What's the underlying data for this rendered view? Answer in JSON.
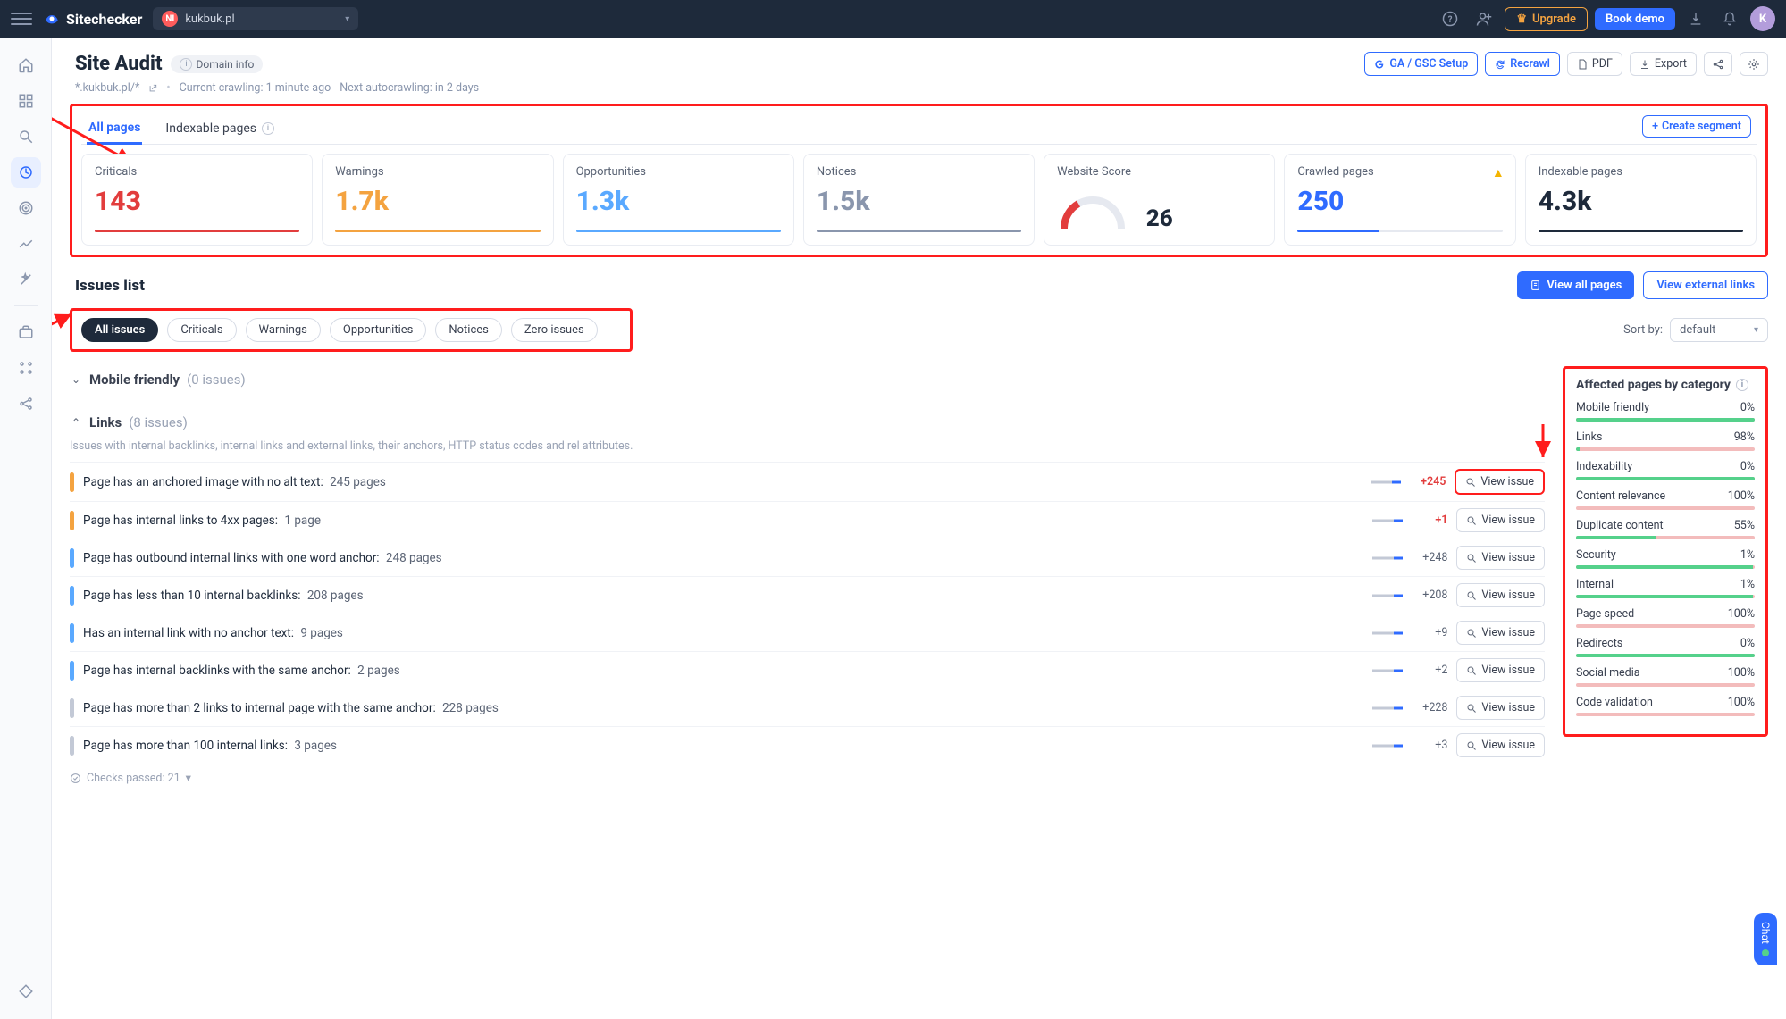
{
  "app": {
    "name": "Sitechecker"
  },
  "project": {
    "badge": "NI",
    "name": "kukbuk.pl"
  },
  "top": {
    "upgrade": "Upgrade",
    "book_demo": "Book demo",
    "avatar_initial": "K"
  },
  "page": {
    "title": "Site Audit",
    "domain_info": "Domain info",
    "crumb_path": "*.kukbuk.pl/*",
    "crawl_current": "Current crawling: 1 minute ago",
    "crawl_next": "Next autocrawling: in 2 days"
  },
  "actions": {
    "ga": "GA / GSC Setup",
    "recrawl": "Recrawl",
    "pdf": "PDF",
    "export": "Export"
  },
  "tabs": {
    "all_pages": "All pages",
    "indexable": "Indexable pages",
    "create_segment": "Create segment"
  },
  "metrics": [
    {
      "label": "Criticals",
      "value": "143",
      "color": "#e23d3d",
      "bar": 100
    },
    {
      "label": "Warnings",
      "value": "1.7k",
      "color": "#f4a340",
      "bar": 100
    },
    {
      "label": "Opportunities",
      "value": "1.3k",
      "color": "#5aa9ff",
      "bar": 100
    },
    {
      "label": "Notices",
      "value": "1.5k",
      "color": "#8a96ad",
      "bar": 100
    },
    {
      "label": "Website Score",
      "value": "26",
      "color": "#1e2a3b",
      "type": "score"
    },
    {
      "label": "Crawled pages",
      "value": "250",
      "color": "#2f6bff",
      "bar": 40,
      "warn": true
    },
    {
      "label": "Indexable pages",
      "value": "4.3k",
      "color": "#1e2a3b",
      "bar": 100
    }
  ],
  "issues": {
    "title": "Issues list",
    "view_all": "View all pages",
    "view_external": "View external links",
    "sort_label": "Sort by:",
    "sort_value": "default",
    "filters": [
      "All issues",
      "Criticals",
      "Warnings",
      "Opportunities",
      "Notices",
      "Zero issues"
    ]
  },
  "groups": {
    "mobile": {
      "name": "Mobile friendly",
      "count": "(0 issues)"
    },
    "links": {
      "name": "Links",
      "count": "(8 issues)",
      "desc": "Issues with internal backlinks, internal links and external links, their anchors, HTTP status codes and rel attributes."
    }
  },
  "link_issues": [
    {
      "sev": "orange",
      "text": "Page has an anchored image with no alt text:",
      "pages": "245 pages",
      "delta": "+245",
      "delta_red": true,
      "hl": true
    },
    {
      "sev": "orange",
      "text": "Page has internal links to 4xx pages:",
      "pages": "1 page",
      "delta": "+1",
      "delta_red": true
    },
    {
      "sev": "blue",
      "text": "Page has outbound internal links with one word anchor:",
      "pages": "248 pages",
      "delta": "+248"
    },
    {
      "sev": "blue",
      "text": "Page has less than 10 internal backlinks:",
      "pages": "208 pages",
      "delta": "+208"
    },
    {
      "sev": "blue",
      "text": "Has an internal link with no anchor text:",
      "pages": "9 pages",
      "delta": "+9"
    },
    {
      "sev": "blue",
      "text": "Page has internal backlinks with the same anchor:",
      "pages": "2 pages",
      "delta": "+2"
    },
    {
      "sev": "grey",
      "text": "Page has more than 2 links to internal page with the same anchor:",
      "pages": "228 pages",
      "delta": "+228"
    },
    {
      "sev": "grey",
      "text": "Page has more than 100 internal links:",
      "pages": "3 pages",
      "delta": "+3"
    }
  ],
  "checks_passed": "Checks passed: 21",
  "view_issue_label": "View issue",
  "categories_title": "Affected pages by category",
  "categories": [
    {
      "name": "Mobile friendly",
      "pct": "0%",
      "fill": 100
    },
    {
      "name": "Links",
      "pct": "98%",
      "fill": 2
    },
    {
      "name": "Indexability",
      "pct": "0%",
      "fill": 100
    },
    {
      "name": "Content relevance",
      "pct": "100%",
      "fill": 0
    },
    {
      "name": "Duplicate content",
      "pct": "55%",
      "fill": 45
    },
    {
      "name": "Security",
      "pct": "1%",
      "fill": 99
    },
    {
      "name": "Internal",
      "pct": "1%",
      "fill": 99
    },
    {
      "name": "Page speed",
      "pct": "100%",
      "fill": 0
    },
    {
      "name": "Redirects",
      "pct": "0%",
      "fill": 100
    },
    {
      "name": "Social media",
      "pct": "100%",
      "fill": 0
    },
    {
      "name": "Code validation",
      "pct": "100%",
      "fill": 0
    }
  ],
  "chat_label": "Chat"
}
